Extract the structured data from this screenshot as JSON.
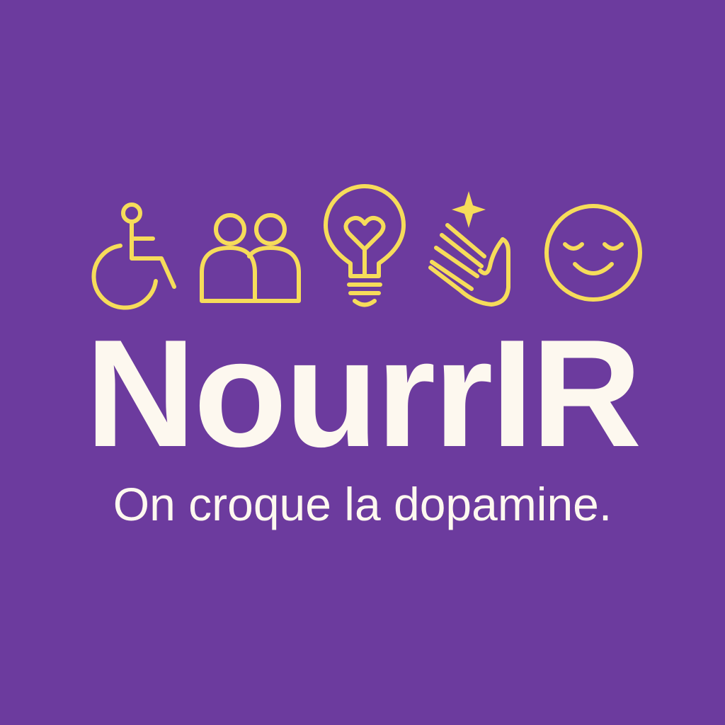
{
  "brand": {
    "name": "NourrIR",
    "tagline": "On croque la dopamine."
  },
  "colors": {
    "background": "#6c3b9e",
    "icon": "#f6dc5a",
    "text": "#fdf8ef"
  },
  "icons": [
    "wheelchair-icon",
    "two-people-icon",
    "heart-lightbulb-icon",
    "sparkle-hand-icon",
    "calm-smiley-icon"
  ]
}
